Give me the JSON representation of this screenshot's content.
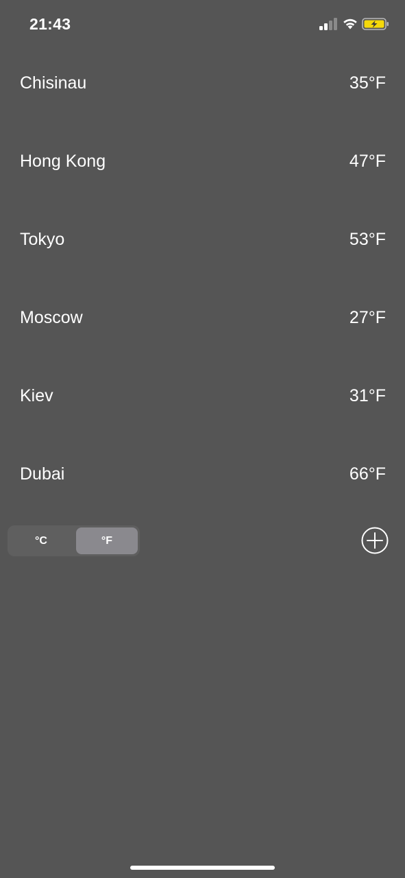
{
  "status_bar": {
    "time": "21:43",
    "signal_icon": "cellular-signal-icon",
    "wifi_icon": "wifi-icon",
    "battery_icon": "battery-charging-icon",
    "battery_color": "#f5d90a"
  },
  "cities": [
    {
      "name": "Chisinau",
      "temp": "35°F"
    },
    {
      "name": "Hong Kong",
      "temp": "47°F"
    },
    {
      "name": "Tokyo",
      "temp": "53°F"
    },
    {
      "name": "Moscow",
      "temp": "27°F"
    },
    {
      "name": "Kiev",
      "temp": "31°F"
    },
    {
      "name": "Dubai",
      "temp": "66°F"
    }
  ],
  "unit_toggle": {
    "celsius_label": "°C",
    "fahrenheit_label": "°F",
    "selected": "°F"
  },
  "add_button_icon": "plus-circle-icon",
  "colors": {
    "background": "#555555",
    "toggle_background": "#5f5f5f",
    "toggle_selected": "#8a898e",
    "text": "#ffffff"
  }
}
